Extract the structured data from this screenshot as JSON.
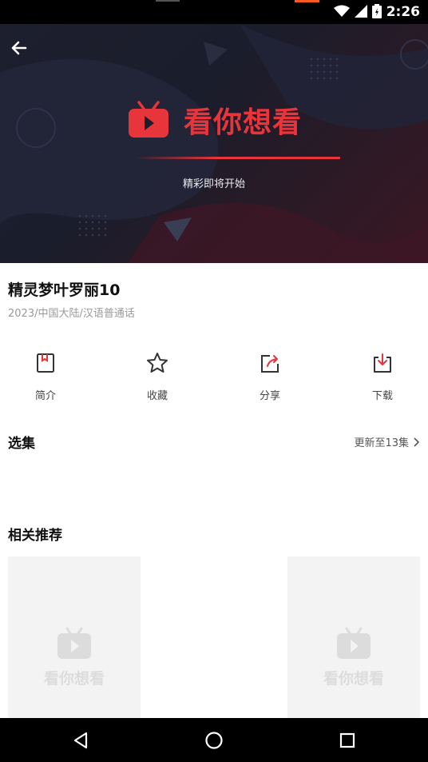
{
  "status_bar": {
    "time": "2:26",
    "icons": [
      "wifi-icon",
      "signal-icon",
      "battery-icon"
    ]
  },
  "player": {
    "logo_text": "看你想看",
    "subtitle": "精彩即将开始",
    "accent": "#e8343b"
  },
  "video": {
    "title": "精灵梦叶罗丽10",
    "meta": "2023/中国大陆/汉语普通话"
  },
  "actions": [
    {
      "label": "简介",
      "icon": "intro-icon"
    },
    {
      "label": "收藏",
      "icon": "star-icon"
    },
    {
      "label": "分享",
      "icon": "share-icon"
    },
    {
      "label": "下载",
      "icon": "download-icon"
    }
  ],
  "episodes": {
    "heading": "选集",
    "more": "更新至13集"
  },
  "recommend": {
    "heading": "相关推荐",
    "placeholder_text": "看你想看"
  },
  "nav": [
    "back-icon",
    "home-icon",
    "recents-icon"
  ]
}
